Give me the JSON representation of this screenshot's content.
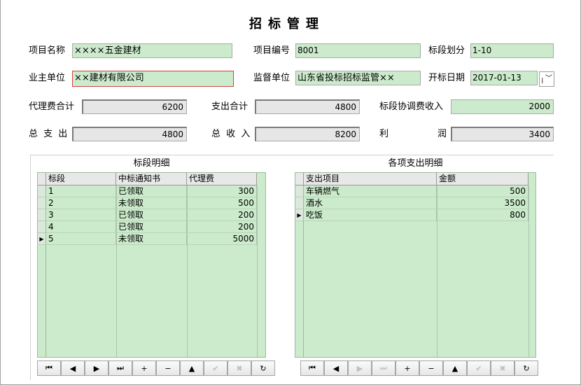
{
  "window": {
    "title": "招标管理"
  },
  "form": {
    "project_name": {
      "label": "项目名称",
      "value": "××××五金建材"
    },
    "project_no": {
      "label": "项目编号",
      "value": "8001"
    },
    "section_div": {
      "label": "标段划分",
      "value": "1-10"
    },
    "owner": {
      "label": "业主单位",
      "value": "××建材有限公司"
    },
    "supervisor": {
      "label": "监督单位",
      "value": "山东省投标招标监管××"
    },
    "open_date": {
      "label": "开标日期",
      "value": "2017-01-13"
    },
    "agency_total": {
      "label": "代理费合计",
      "value": "6200"
    },
    "expense_total": {
      "label": "支出合计",
      "value": "4800"
    },
    "coord_income": {
      "label": "标段协调费收入",
      "value": "2000"
    },
    "total_expense": {
      "label": "总 支 出",
      "value": "4800"
    },
    "total_income": {
      "label": "总 收 入",
      "value": "8200"
    },
    "profit": {
      "label_left": "利",
      "label_right": "润",
      "value": "3400"
    }
  },
  "left_grid": {
    "title": "标段明细",
    "columns": [
      "标段",
      "中标通知书",
      "代理费"
    ],
    "rows": [
      {
        "c1": "1",
        "c2": "已领取",
        "c3": "300"
      },
      {
        "c1": "2",
        "c2": "未领取",
        "c3": "500"
      },
      {
        "c1": "3",
        "c2": "已领取",
        "c3": "200"
      },
      {
        "c1": "4",
        "c2": "已领取",
        "c3": "200"
      },
      {
        "c1": "5",
        "c2": "未领取",
        "c3": "5000"
      }
    ],
    "current_row": 4
  },
  "right_grid": {
    "title": "各项支出明细",
    "columns": [
      "支出项目",
      "金额"
    ],
    "rows": [
      {
        "c1": "车辆燃气",
        "c2": "500"
      },
      {
        "c1": "酒水",
        "c2": "3500"
      },
      {
        "c1": "吃饭",
        "c2": "800"
      }
    ],
    "current_row": 2
  },
  "navigator": {
    "buttons": [
      "first",
      "prior",
      "next",
      "last",
      "insert",
      "delete",
      "edit",
      "post",
      "cancel",
      "refresh"
    ],
    "glyphs": [
      "⏮",
      "◀",
      "▶",
      "⏭",
      "+",
      "−",
      "▲",
      "✔",
      "✖",
      "↻"
    ]
  },
  "colors": {
    "field_green": "#ccebcc",
    "field_gray": "#e6e6e6",
    "error_border": "#d24040"
  }
}
